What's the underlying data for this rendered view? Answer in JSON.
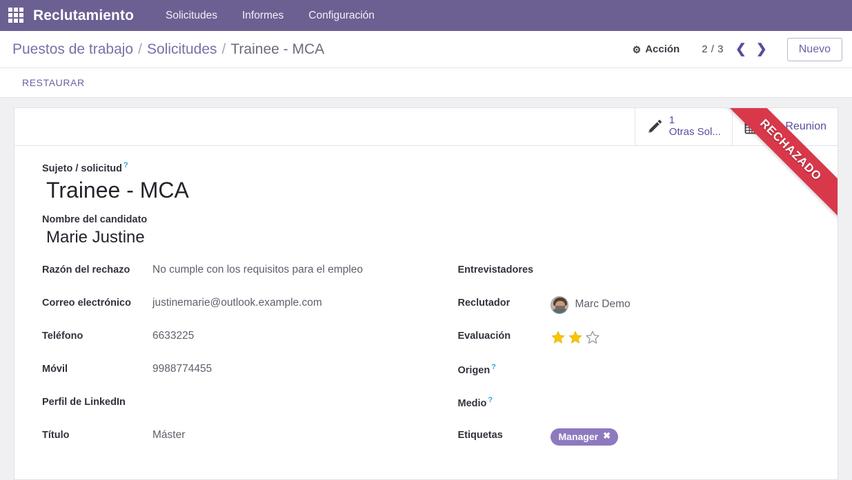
{
  "navbar": {
    "apps_icon": "apps-grid-icon",
    "brand": "Reclutamiento",
    "menu": [
      {
        "label": "Solicitudes"
      },
      {
        "label": "Informes"
      },
      {
        "label": "Configuración"
      }
    ]
  },
  "control_panel": {
    "breadcrumb": [
      {
        "label": "Puestos de trabajo",
        "current": false
      },
      {
        "label": "Solicitudes",
        "current": false
      },
      {
        "label": "Trainee - MCA",
        "current": true
      }
    ],
    "separator": "/",
    "action_label": "Acción",
    "action_icon": "gear-icon",
    "pager": "2 / 3",
    "prev_icon": "chevron-left-icon",
    "prev_glyph": "❮",
    "next_icon": "chevron-right-icon",
    "next_glyph": "❯",
    "new_label": "Nuevo"
  },
  "statusbar": {
    "restore_label": "RESTAURAR"
  },
  "stat_buttons": [
    {
      "icon": "pencil-icon",
      "value": "1",
      "label": "Otras Sol...",
      "stacked": true
    },
    {
      "icon": "calendar-icon",
      "value": "",
      "label": "Sin Reunion",
      "stacked": false
    }
  ],
  "ribbon": {
    "label": "RECHAZADO",
    "color": "#d9384b"
  },
  "form": {
    "title_label": "Sujeto / solicitud",
    "title_help": "?",
    "title_value": "Trainee - MCA",
    "subtitle_label": "Nombre del candidato",
    "subtitle_value": "Marie Justine",
    "left_fields": [
      {
        "label": "Razón del rechazo",
        "value": "No cumple con los requisitos para el empleo",
        "help": ""
      },
      {
        "label": "Correo electrónico",
        "value": "justinemarie@outlook.example.com",
        "help": ""
      },
      {
        "label": "Teléfono",
        "value": "6633225",
        "help": ""
      },
      {
        "label": "Móvil",
        "value": "9988774455",
        "help": ""
      },
      {
        "label": "Perfil de LinkedIn",
        "value": "",
        "help": ""
      },
      {
        "label": "Título",
        "value": "Máster",
        "help": ""
      }
    ],
    "right_fields": [
      {
        "label": "Entrevistadores",
        "value": "",
        "help": "",
        "type": "text"
      },
      {
        "label": "Reclutador",
        "value": "Marc Demo",
        "help": "",
        "type": "avatar"
      },
      {
        "label": "Evaluación",
        "value": "",
        "help": "",
        "type": "stars"
      },
      {
        "label": "Origen",
        "value": "",
        "help": "?",
        "type": "text"
      },
      {
        "label": "Medio",
        "value": "",
        "help": "?",
        "type": "text"
      },
      {
        "label": "Etiquetas",
        "value": "",
        "help": "",
        "type": "tags"
      }
    ],
    "rating": {
      "filled": 2,
      "total": 3,
      "star_filled_color": "#f6c600",
      "star_empty_color": "#9a9aa8"
    },
    "tags": [
      {
        "label": "Manager",
        "remove_glyph": "✖",
        "color": "#8e79bf"
      }
    ]
  },
  "theme": {
    "navbar_bg": "#6c6092",
    "accent": "#5b4c9c",
    "breadcrumb_color": "#7b6fa8",
    "page_bg": "#f0f0f3"
  }
}
